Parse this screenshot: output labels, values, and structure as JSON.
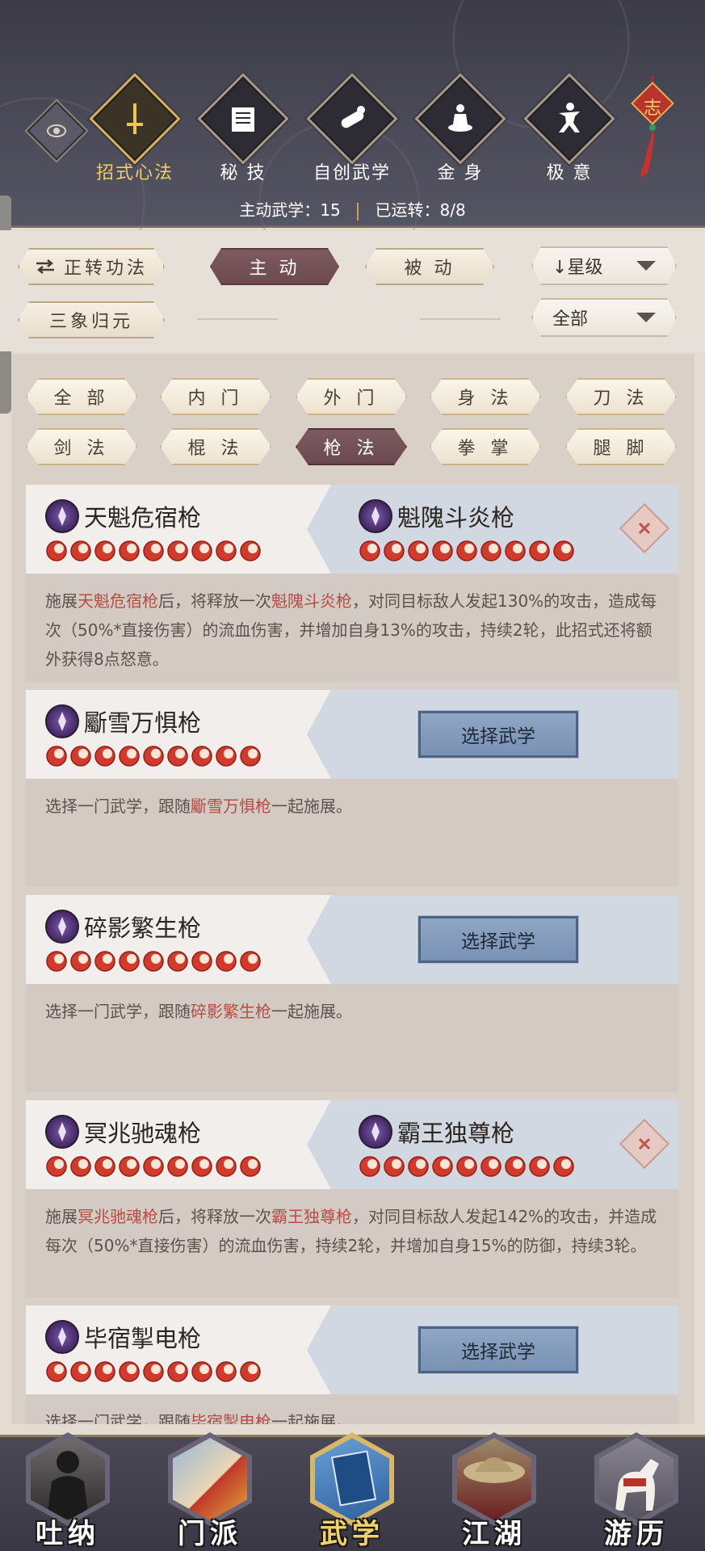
{
  "header": {
    "tabs": [
      {
        "label": "招式心法",
        "icon": "sword-icon",
        "active": true
      },
      {
        "label": "秘 技",
        "icon": "book-icon",
        "active": false
      },
      {
        "label": "自创武学",
        "icon": "scroll-icon",
        "active": false
      },
      {
        "label": "金 身",
        "icon": "meditation-icon",
        "active": false
      },
      {
        "label": "极 意",
        "icon": "martial-pose-icon",
        "active": false
      }
    ],
    "knot_char": "志",
    "stats": {
      "active_label": "主动武学：",
      "active_value": "15",
      "running_label": "已运转：",
      "running_value": "8/8"
    }
  },
  "filters": {
    "switch_label": "正转功法",
    "active_label": "主 动",
    "passive_label": "被 动",
    "sanxiang_label": "三象归元",
    "sort_label": "星级",
    "scope_label": "全部"
  },
  "categories": [
    "全 部",
    "内 门",
    "外 门",
    "身 法",
    "刀 法",
    "剑 法",
    "棍 法",
    "枪 法",
    "拳 掌",
    "腿 脚"
  ],
  "active_category": "枪 法",
  "cards": [
    {
      "left_name": "天魁危宿枪",
      "right_name": "魁隗斗炎枪",
      "stars": 9,
      "desc_parts": [
        {
          "t": "施展",
          "hl": false
        },
        {
          "t": "天魁危宿枪",
          "hl": true
        },
        {
          "t": "后，将释放一次",
          "hl": false
        },
        {
          "t": "魁隗斗炎枪",
          "hl": true
        },
        {
          "t": "，对同目标敌人发起130%的攻击，造成每次（50%*直接伤害）的流血伤害，并增加自身13%的攻击，持续2轮，此招式还将额外获得8点怒意。",
          "hl": false
        }
      ]
    },
    {
      "left_name": "斸雪万惧枪",
      "select_label": "选择武学",
      "stars": 9,
      "desc_parts": [
        {
          "t": "选择一门武学，跟随",
          "hl": false
        },
        {
          "t": "斸雪万惧枪",
          "hl": true
        },
        {
          "t": "一起施展。",
          "hl": false
        }
      ]
    },
    {
      "left_name": "碎影繁生枪",
      "select_label": "选择武学",
      "stars": 9,
      "desc_parts": [
        {
          "t": "选择一门武学，跟随",
          "hl": false
        },
        {
          "t": "碎影繁生枪",
          "hl": true
        },
        {
          "t": "一起施展。",
          "hl": false
        }
      ]
    },
    {
      "left_name": "冥兆驰魂枪",
      "right_name": "霸王独尊枪",
      "stars": 9,
      "desc_parts": [
        {
          "t": "施展",
          "hl": false
        },
        {
          "t": "冥兆驰魂枪",
          "hl": true
        },
        {
          "t": "后，将释放一次",
          "hl": false
        },
        {
          "t": "霸王独尊枪",
          "hl": true
        },
        {
          "t": "，对同目标敌人发起142%的攻击，并造成每次（50%*直接伤害）的流血伤害，持续2轮，并增加自身15%的防御，持续3轮。",
          "hl": false
        }
      ]
    },
    {
      "left_name": "毕宿掣电枪",
      "select_label": "选择武学",
      "stars": 9,
      "desc_parts": [
        {
          "t": "选择一门武学，跟随",
          "hl": false
        },
        {
          "t": "毕宿掣电枪",
          "hl": true
        },
        {
          "t": "一起施展。",
          "hl": false
        }
      ]
    }
  ],
  "bottom_nav": [
    {
      "label": "吐纳",
      "icon": "monk-portrait-icon",
      "active": false
    },
    {
      "label": "门派",
      "icon": "sect-banner-icon",
      "active": false
    },
    {
      "label": "武学",
      "icon": "manual-book-icon",
      "active": true
    },
    {
      "label": "江湖",
      "icon": "straw-hat-icon",
      "active": false
    },
    {
      "label": "游历",
      "icon": "white-horse-icon",
      "active": false
    }
  ],
  "colors": {
    "accent_gold": "#f1cf5e",
    "highlight_red": "#b54c43",
    "active_tab": "#6c4a50",
    "select_button": "#7991b3"
  }
}
